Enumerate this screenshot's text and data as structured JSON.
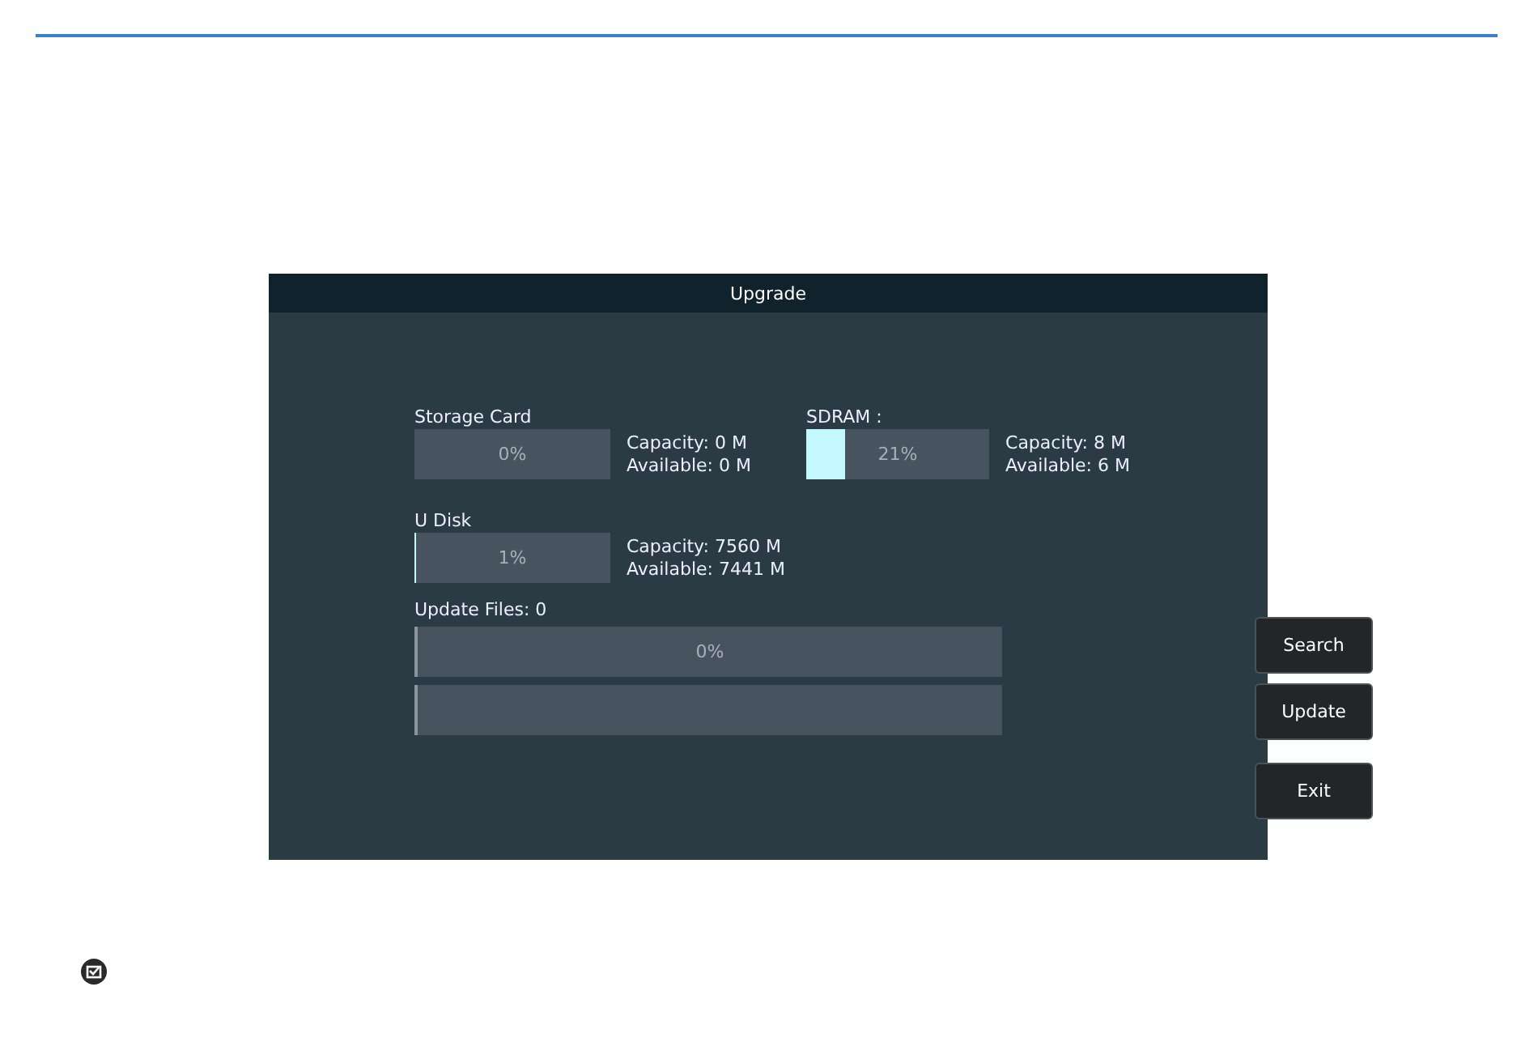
{
  "dialog": {
    "title": "Upgrade",
    "storage": [
      {
        "label": "Storage Card",
        "level": 0,
        "reading": "0%",
        "capacity": "Capacity: 0 M",
        "available": "Available: 0 M"
      },
      {
        "label": "SDRAM :",
        "level": 0.21,
        "reading": "21%",
        "capacity": "Capacity: 8 M",
        "available": "Available: 6 M"
      },
      {
        "label": "U Disk",
        "level": 0.01,
        "reading": "1%",
        "capacity": "Capacity: 7560 M",
        "available": "Available: 7441 M"
      }
    ],
    "update_files": {
      "label": "Update Files: 0",
      "level": 0,
      "reading": "0%"
    },
    "buttons": [
      "Search",
      "Update",
      "Exit"
    ]
  }
}
